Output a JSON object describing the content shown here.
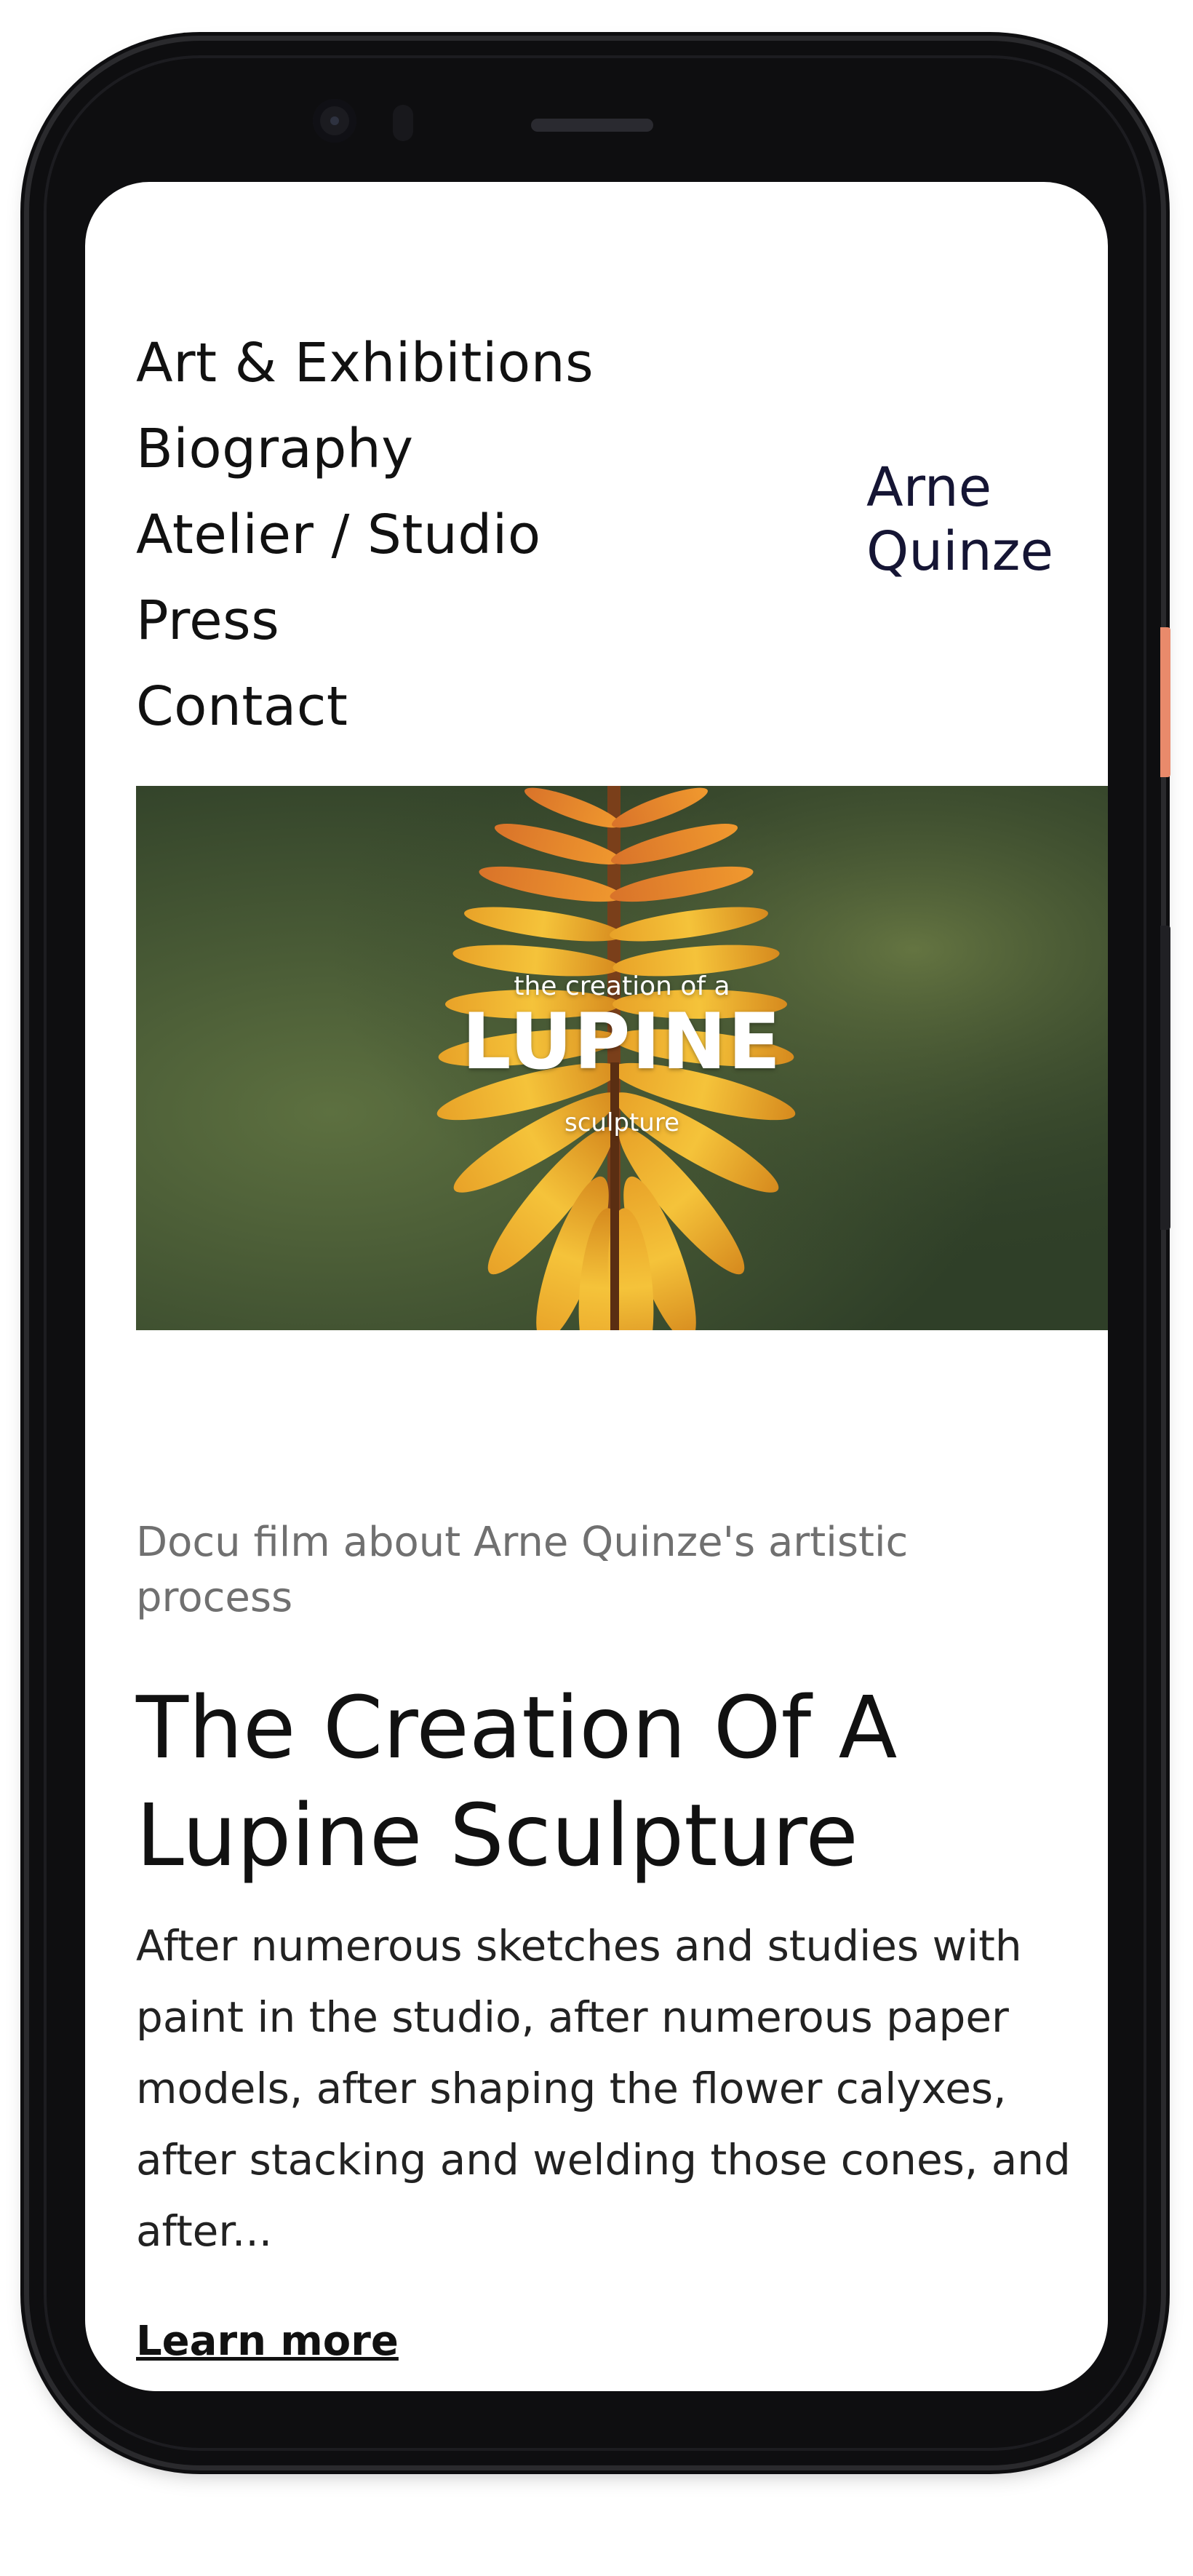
{
  "nav": {
    "items": [
      {
        "label": "Art & Exhibitions"
      },
      {
        "label": "Biography"
      },
      {
        "label": "Atelier / Studio"
      },
      {
        "label": "Press"
      },
      {
        "label": "Contact"
      }
    ]
  },
  "logo": {
    "line1": "Arne",
    "line2": "Quinze"
  },
  "hero": {
    "kicker": "the creation of a",
    "title": "LUPINE",
    "sub": "sculpture"
  },
  "article": {
    "kicker": "Docu film about Arne Quinze's artistic process",
    "title": "The Creation Of A Lupine Sculpture",
    "excerpt": "After numerous sketches and studies with paint in the studio, after numerous paper models, after shaping the flower calyxes, after stacking and welding those cones, and after...",
    "cta": "Learn more"
  },
  "colors": {
    "phone_frame": "#0e0e10",
    "logo_text": "#151534",
    "kicker_text": "#707070",
    "side_button": "#e98a6b"
  }
}
